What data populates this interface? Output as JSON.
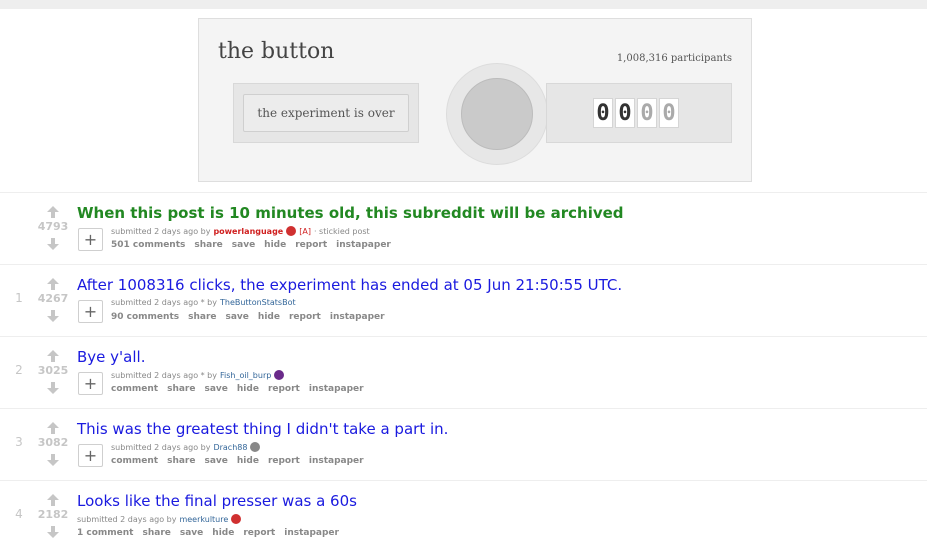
{
  "widget": {
    "title": "the button",
    "participants": "1,008,316 participants",
    "status": "the experiment is over",
    "timer_digits": [
      "0",
      "0",
      "0",
      "0"
    ],
    "timer_digit_states": [
      "on",
      "on",
      "off",
      "off"
    ]
  },
  "posts": [
    {
      "rank": "",
      "score": "4793",
      "title": "When this post is 10 minutes old, this subreddit will be archived",
      "sticky": true,
      "submitted": "submitted 2 days ago by",
      "author": "powerlanguage",
      "flair_color": "#d03030",
      "admin_tag": "[A]",
      "extra": "· stickied post",
      "comments": "501 comments"
    },
    {
      "rank": "1",
      "score": "4267",
      "title": "After 1008316 clicks, the experiment has ended at 05 Jun 21:50:55 UTC.",
      "sticky": false,
      "submitted": "submitted 2 days ago * by",
      "author": "TheButtonStatsBot",
      "flair_color": "",
      "admin_tag": "",
      "extra": "",
      "comments": "90 comments"
    },
    {
      "rank": "2",
      "score": "3025",
      "title": "Bye y'all.",
      "sticky": false,
      "submitted": "submitted 2 days ago * by",
      "author": "Fish_oil_burp",
      "flair_color": "#6a2a8a",
      "admin_tag": "",
      "extra": "",
      "comments": "comment"
    },
    {
      "rank": "3",
      "score": "3082",
      "title": "This was the greatest thing I didn't take a part in.",
      "sticky": false,
      "submitted": "submitted 2 days ago by",
      "author": "Drach88",
      "flair_color": "#888888",
      "admin_tag": "",
      "extra": "",
      "comments": "comment"
    },
    {
      "rank": "4",
      "score": "2182",
      "title": "Looks like the final presser was a 60s",
      "sticky": false,
      "submitted": "submitted 2 days ago by",
      "author": "meerkulture",
      "flair_color": "#d03030",
      "admin_tag": "",
      "extra": "",
      "comments": "1 comment"
    }
  ],
  "actions": {
    "share": "share",
    "save": "save",
    "hide": "hide",
    "report": "report",
    "instapaper": "instapaper"
  },
  "expand_symbol": "+",
  "colors": {
    "link": "#1a1adf",
    "sticky_title": "#228822",
    "admin": "#d02020"
  },
  "icons": {
    "upvote": "upvote-arrow-icon",
    "downvote": "downvote-arrow-icon",
    "expand": "expand-plus-icon",
    "flair": "flair-dot-icon"
  }
}
